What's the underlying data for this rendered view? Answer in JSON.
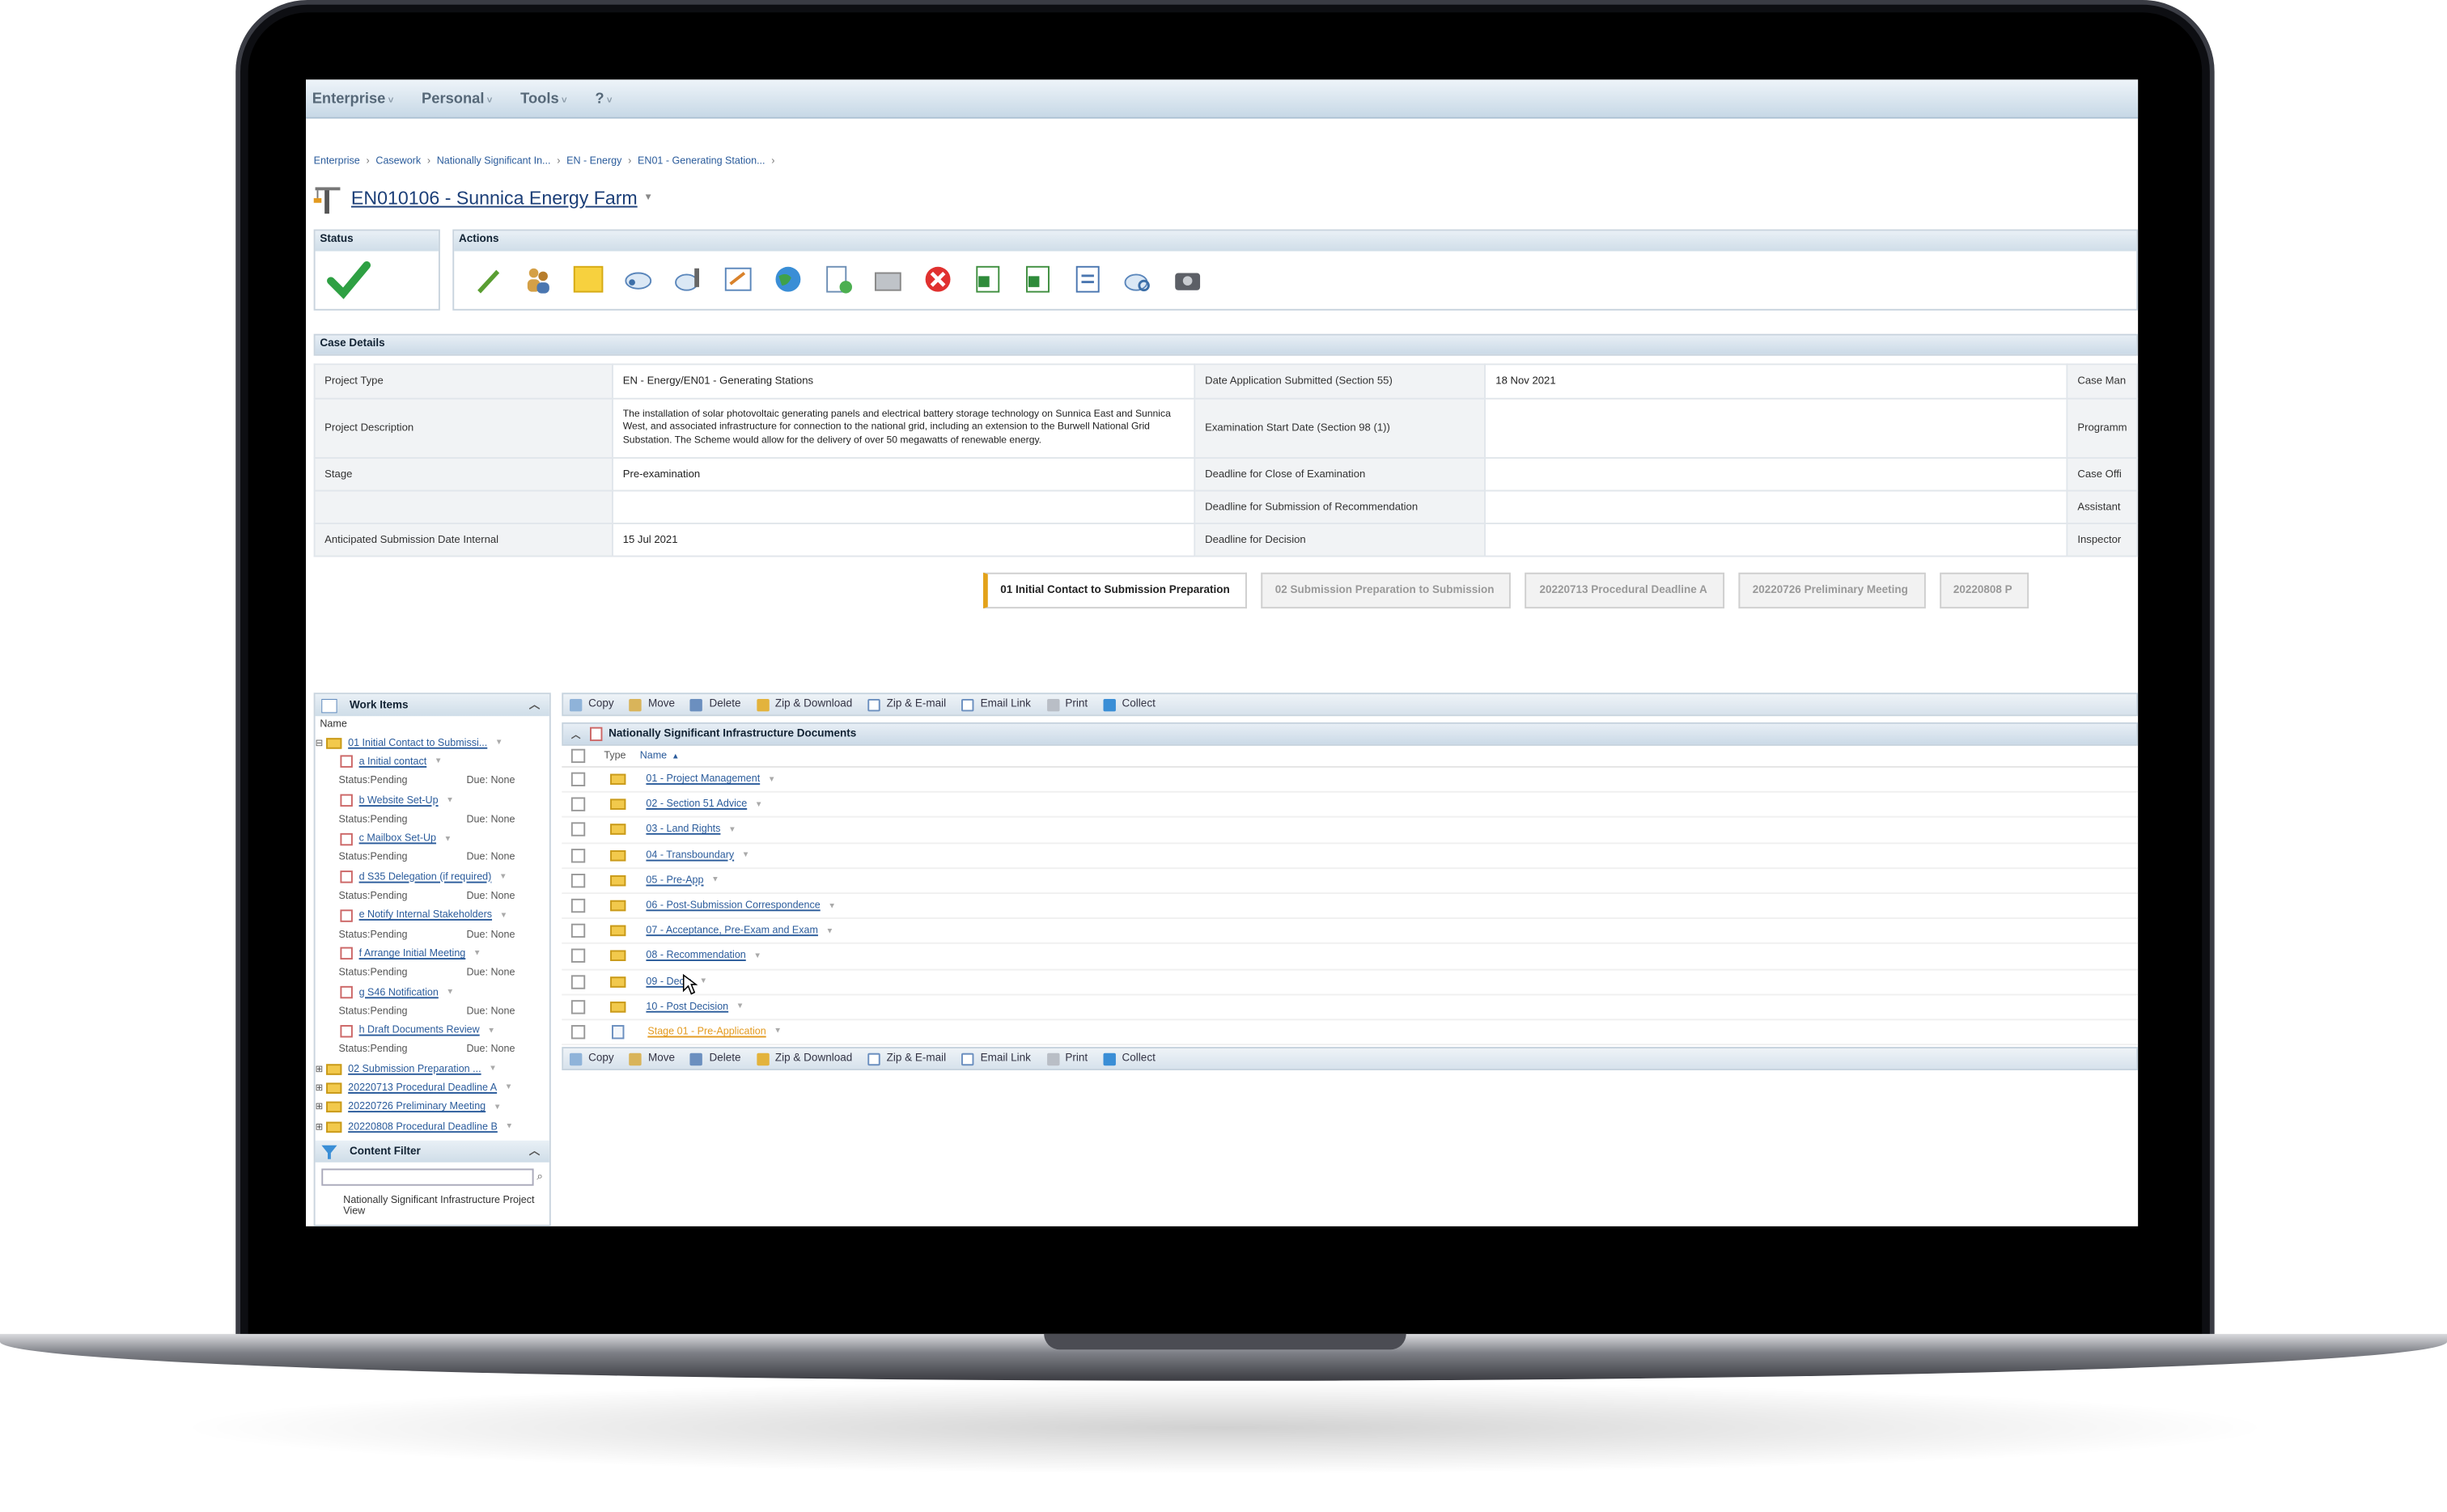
{
  "menu": [
    "Enterprise",
    "Personal",
    "Tools",
    "?"
  ],
  "breadcrumb": [
    "Enterprise",
    "Casework",
    "Nationally Significant In...",
    "EN - Energy",
    "EN01 - Generating Station..."
  ],
  "page_title": "EN010106 - Sunnica Energy Farm",
  "status_header": "Status",
  "actions_header": "Actions",
  "action_icons": [
    "edit-icon",
    "users-icon",
    "note-icon",
    "cloud-link-icon",
    "people-link-icon",
    "form-icon",
    "globe-icon",
    "add-document-icon",
    "folder-open-icon",
    "cancel-icon",
    "excel-icon",
    "excel-export-icon",
    "document-icon",
    "search-cloud-icon",
    "camera-icon"
  ],
  "case_details_header": "Case Details",
  "case_details": {
    "project_type_label": "Project Type",
    "project_type": "EN - Energy/EN01 - Generating Stations",
    "project_description_label": "Project Description",
    "project_description": "The installation of solar photovoltaic generating panels and electrical battery storage technology on Sunnica East and Sunnica West, and associated infrastructure for connection to the national grid, including an extension to the Burwell National Grid Substation. The Scheme would allow for the delivery of over 50 megawatts of renewable energy.",
    "stage_label": "Stage",
    "stage": "Pre-examination",
    "anticipated_label": "Anticipated Submission Date Internal",
    "anticipated": "15 Jul 2021",
    "date_submitted_label": "Date Application Submitted (Section 55)",
    "date_submitted": "18 Nov 2021",
    "exam_start_label": "Examination Start Date (Section 98 (1))",
    "deadline_close_label": "Deadline for Close of Examination",
    "deadline_recommendation_label": "Deadline for Submission of Recommendation",
    "deadline_decision_label": "Deadline for Decision",
    "right_col": [
      "Case Man",
      "Programm",
      "Case Offi",
      "Assistant",
      "Inspector"
    ]
  },
  "stages": [
    "01 Initial Contact to Submission Preparation",
    "02 Submission Preparation to Submission",
    "20220713 Procedural Deadline A",
    "20220726 Preliminary Meeting",
    "20220808 P"
  ],
  "work_items": {
    "header": "Work Items",
    "name_col": "Name",
    "group_open": "01 Initial Contact to Submissi...",
    "items": [
      {
        "label": "a Initial contact",
        "status": "Status:Pending",
        "due": "Due: None"
      },
      {
        "label": "b Website Set-Up",
        "status": "Status:Pending",
        "due": "Due: None"
      },
      {
        "label": "c Mailbox Set-Up",
        "status": "Status:Pending",
        "due": "Due: None"
      },
      {
        "label": "d S35 Delegation (if required)",
        "status": "Status:Pending",
        "due": "Due: None"
      },
      {
        "label": "e Notify Internal Stakeholders",
        "status": "Status:Pending",
        "due": "Due: None"
      },
      {
        "label": "f Arrange Initial Meeting",
        "status": "Status:Pending",
        "due": "Due: None"
      },
      {
        "label": "g S46 Notification",
        "status": "Status:Pending",
        "due": "Due: None"
      },
      {
        "label": "h Draft Documents Review",
        "status": "Status:Pending",
        "due": "Due: None"
      }
    ],
    "groups_closed": [
      "02 Submission Preparation ...",
      "20220713 Procedural Deadline A",
      "20220726 Preliminary Meeting",
      "20220808 Procedural Deadline B"
    ]
  },
  "content_filter": {
    "header": "Content Filter",
    "view": "Nationally Significant Infrastructure Project View"
  },
  "doc_toolbar": [
    "Copy",
    "Move",
    "Delete",
    "Zip & Download",
    "Zip & E-mail",
    "Email Link",
    "Print",
    "Collect"
  ],
  "documents": {
    "header": "Nationally Significant Infrastructure Documents",
    "col_type": "Type",
    "col_name": "Name",
    "rows": [
      {
        "name": "01 - Project Management",
        "type": "folder"
      },
      {
        "name": "02 - Section 51 Advice",
        "type": "folder"
      },
      {
        "name": "03 - Land Rights",
        "type": "folder"
      },
      {
        "name": "04 - Transboundary",
        "type": "folder"
      },
      {
        "name": "05 - Pre-App",
        "type": "folder"
      },
      {
        "name": "06 - Post-Submission Correspondence",
        "type": "folder"
      },
      {
        "name": "07 - Acceptance, Pre-Exam and Exam",
        "type": "folder"
      },
      {
        "name": "08 - Recommendation",
        "type": "folder"
      },
      {
        "name": "09 - Decis",
        "type": "folder"
      },
      {
        "name": "10 - Post Decision",
        "type": "folder"
      },
      {
        "name": "Stage 01 - Pre-Application",
        "type": "document"
      }
    ]
  }
}
